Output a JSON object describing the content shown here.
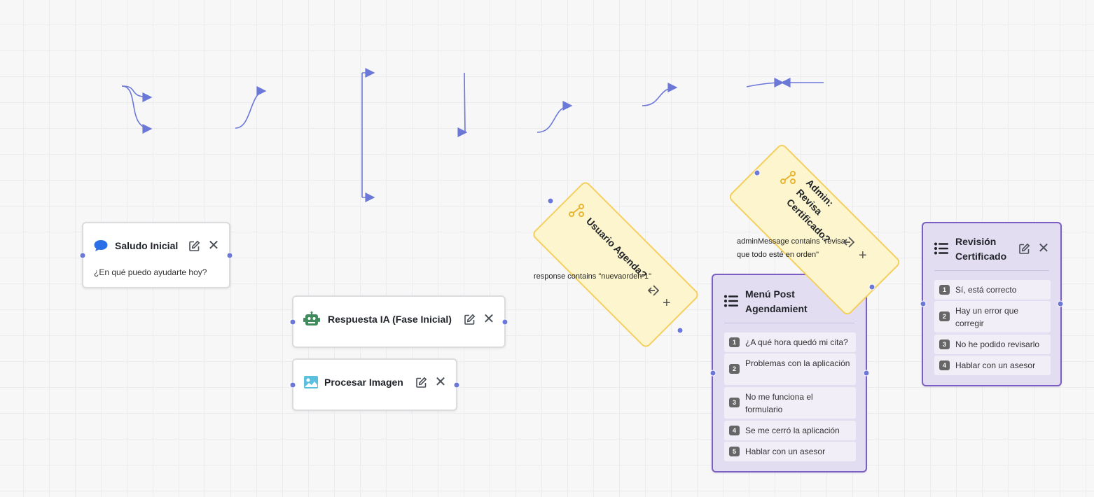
{
  "canvas": {
    "edge_color": "#6b78d8",
    "background": "#f7f7f8"
  },
  "nodes": {
    "saludo": {
      "title": "Saludo Inicial",
      "subtitle": "¿En qué puedo ayudarte hoy?",
      "icon": "chat-bubble-icon",
      "edit_icon": "edit-icon",
      "close_label": "✕"
    },
    "respuesta_ia": {
      "title": "Respuesta IA (Fase Inicial)",
      "icon": "robot-icon",
      "edit_icon": "edit-icon",
      "close_label": "✕"
    },
    "procesar_imagen": {
      "title": "Procesar Imagen",
      "icon": "image-icon",
      "edit_icon": "edit-icon",
      "close_label": "✕"
    },
    "menu_post": {
      "title_line1": "Menú Post",
      "title_line2": "Agendamient",
      "icon": "list-icon",
      "options": [
        {
          "num": "1",
          "label": "¿A qué hora quedó mi cita?"
        },
        {
          "num": "2",
          "label": "Problemas con la aplicación"
        },
        {
          "num": "3",
          "label": "No me funciona el formulario"
        },
        {
          "num": "4",
          "label": "Se me cerró la aplicación"
        },
        {
          "num": "5",
          "label": "Hablar con un asesor"
        }
      ]
    },
    "revision": {
      "title_line1": "Revisión",
      "title_line2": "Certificado",
      "icon": "list-icon",
      "edit_icon": "edit-icon",
      "close_label": "✕",
      "options": [
        {
          "num": "1",
          "label": "Sí, está correcto"
        },
        {
          "num": "2",
          "label": "Hay un error que corregir"
        },
        {
          "num": "3",
          "label": "No he podido revisarlo"
        },
        {
          "num": "4",
          "label": "Hablar con un asesor"
        }
      ]
    },
    "usuario_agenda": {
      "title": "Usuario Agenda?",
      "condition": "response contains \"nuevaorden-1\"",
      "icon": "branch-icon",
      "plus": "+"
    },
    "admin_revisa": {
      "title_line1": "Admin:",
      "title_line2": "Revisa",
      "title_line3": "Certificado?",
      "condition_line1": "adminMessage contains \"revisa",
      "condition_line2": "que todo esté en orden\"",
      "icon": "branch-icon",
      "plus": "+"
    }
  }
}
